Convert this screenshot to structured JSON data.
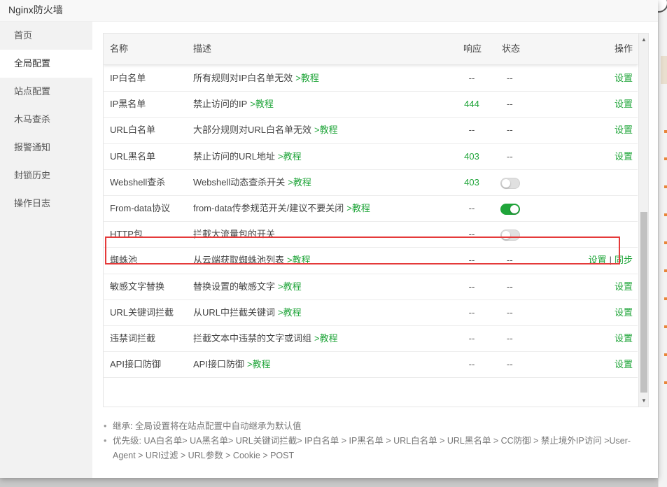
{
  "window": {
    "title": "Nginx防火墙"
  },
  "sidebar": {
    "items": [
      {
        "label": "首页",
        "active": false
      },
      {
        "label": "全局配置",
        "active": true
      },
      {
        "label": "站点配置",
        "active": false
      },
      {
        "label": "木马查杀",
        "active": false
      },
      {
        "label": "报警通知",
        "active": false
      },
      {
        "label": "封锁历史",
        "active": false
      },
      {
        "label": "操作日志",
        "active": false
      }
    ]
  },
  "table": {
    "headers": {
      "name": "名称",
      "desc": "描述",
      "resp": "响应",
      "state": "状态",
      "op": "操作"
    },
    "rows": [
      {
        "name": "IP白名单",
        "desc": "所有规则对IP白名单无效",
        "link": ">教程",
        "resp": "--",
        "resp_green": false,
        "state_text": "--",
        "toggle": null,
        "ops": [
          "设置"
        ]
      },
      {
        "name": "IP黑名单",
        "desc": "禁止访问的IP",
        "link": ">教程",
        "resp": "444",
        "resp_green": true,
        "state_text": "--",
        "toggle": null,
        "ops": [
          "设置"
        ]
      },
      {
        "name": "URL白名单",
        "desc": "大部分规则对URL白名单无效",
        "link": ">教程",
        "resp": "--",
        "resp_green": false,
        "state_text": "--",
        "toggle": null,
        "ops": [
          "设置"
        ]
      },
      {
        "name": "URL黑名单",
        "desc": "禁止访问的URL地址",
        "link": ">教程",
        "resp": "403",
        "resp_green": true,
        "state_text": "--",
        "toggle": null,
        "ops": [
          "设置"
        ]
      },
      {
        "name": "Webshell查杀",
        "desc": "Webshell动态查杀开关",
        "link": ">教程",
        "resp": "403",
        "resp_green": true,
        "state_text": "",
        "toggle": "off",
        "ops": []
      },
      {
        "name": "From-data协议",
        "desc": "from-data传参规范开关/建议不要关闭",
        "link": ">教程",
        "resp": "--",
        "resp_green": false,
        "state_text": "",
        "toggle": "on",
        "ops": []
      },
      {
        "name": "HTTP包",
        "desc": "拦截大流量包的开关",
        "link": "",
        "resp": "--",
        "resp_green": false,
        "state_text": "",
        "toggle": "off",
        "ops": []
      },
      {
        "name": "蜘蛛池",
        "desc": "从云端获取蜘蛛池列表",
        "link": ">教程",
        "resp": "--",
        "resp_green": false,
        "state_text": "--",
        "toggle": null,
        "ops": [
          "设置",
          "同步"
        ]
      },
      {
        "name": "敏感文字替换",
        "desc": "替换设置的敏感文字",
        "link": ">教程",
        "resp": "--",
        "resp_green": false,
        "state_text": "--",
        "toggle": null,
        "ops": [
          "设置"
        ]
      },
      {
        "name": "URL关键词拦截",
        "desc": "从URL中拦截关键词",
        "link": ">教程",
        "resp": "--",
        "resp_green": false,
        "state_text": "--",
        "toggle": null,
        "ops": [
          "设置"
        ]
      },
      {
        "name": "违禁词拦截",
        "desc": "拦截文本中违禁的文字或词组",
        "link": ">教程",
        "resp": "--",
        "resp_green": false,
        "state_text": "--",
        "toggle": null,
        "ops": [
          "设置"
        ]
      },
      {
        "name": "API接口防御",
        "desc": "API接口防御",
        "link": ">教程",
        "resp": "--",
        "resp_green": false,
        "state_text": "--",
        "toggle": null,
        "ops": [
          "设置"
        ]
      }
    ],
    "op_separator": "|"
  },
  "notes": [
    "继承: 全局设置将在站点配置中自动继承为默认值",
    "优先级: UA白名单> UA黑名单> URL关键词拦截> IP白名单 > IP黑名单 > URL白名单 > URL黑名单 > CC防御 > 禁止境外IP访问 >User-Agent > URI过滤 > URL参数 > Cookie > POST"
  ],
  "colors": {
    "accent": "#20a53a",
    "highlight": "#e53a3a"
  },
  "icons": {
    "scroll_up": "triangle-up-icon",
    "scroll_down": "triangle-down-icon"
  }
}
